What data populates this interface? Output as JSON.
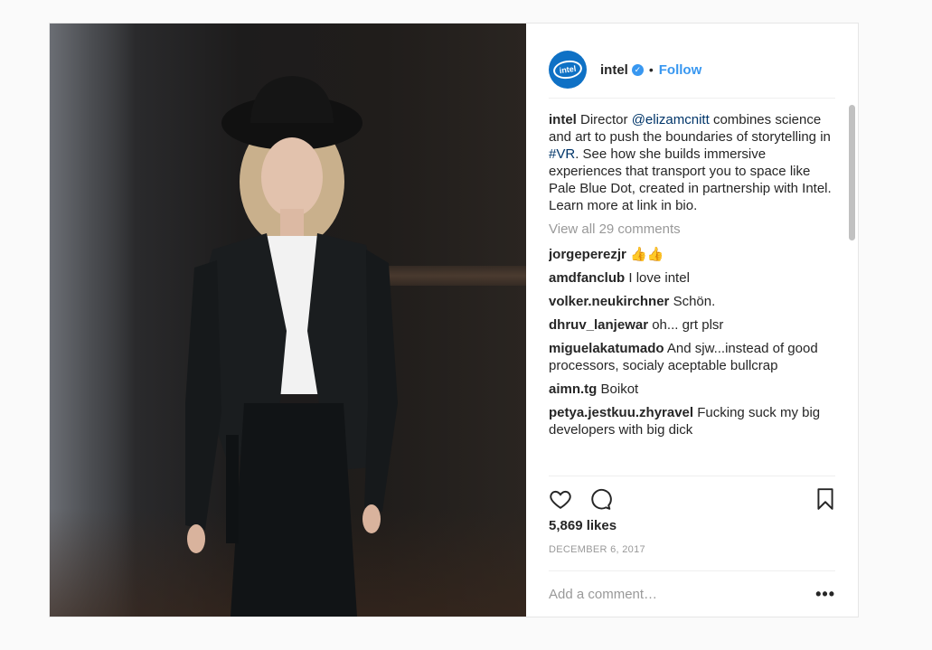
{
  "post": {
    "account": {
      "username": "intel",
      "avatar_text": "intel",
      "follow_label": "Follow",
      "separator": "•"
    },
    "caption": {
      "username": "intel",
      "text_1": " Director ",
      "mention": "@elizamcnitt",
      "text_2": " combines science and art to push the boundaries of storytelling in ",
      "hashtag": "#VR",
      "text_3": ". See how she builds immersive experiences that transport you to space like Pale Blue Dot, created in partnership with Intel. Learn more at link in bio."
    },
    "view_all_label": "View all 29 comments",
    "comments": [
      {
        "user": "jorgeperezjr",
        "text": "👍👍"
      },
      {
        "user": "amdfanclub",
        "text": "I love intel"
      },
      {
        "user": "volker.neukirchner",
        "text": "Schön."
      },
      {
        "user": "dhruv_lanjewar",
        "text": "oh... grt plsr"
      },
      {
        "user": "miguelakatumado",
        "text": "And sjw...instead of good processors, socialy aceptable bullcrap"
      },
      {
        "user": "aimn.tg",
        "text": "Boikot"
      },
      {
        "user": "petya.jestkuu.zhyravel",
        "text": "Fucking suck my big developers with big dick"
      }
    ],
    "likes": "5,869 likes",
    "date": "DECEMBER 6, 2017",
    "add_comment_placeholder": "Add a comment…",
    "more_label": "•••"
  },
  "icons": [
    "heart-icon",
    "comment-icon",
    "bookmark-icon",
    "verified-icon"
  ],
  "colors": {
    "link": "#3897f0",
    "mention": "#003569",
    "muted": "#999999",
    "avatar_bg": "#0f71c5"
  }
}
